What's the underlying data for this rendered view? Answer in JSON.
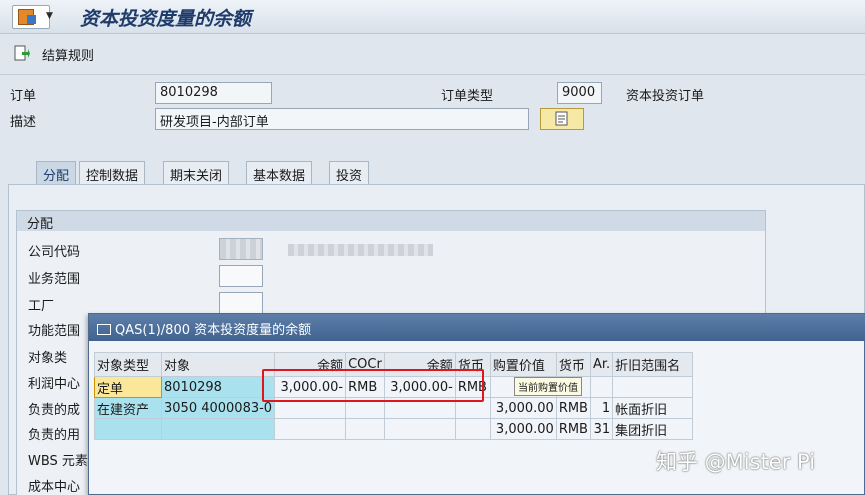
{
  "header": {
    "title": "资本投资度量的余额"
  },
  "toolbar": {
    "settlement_rule_label": "结算规则"
  },
  "order": {
    "order_label": "订单",
    "order_value": "8010298",
    "order_type_label": "订单类型",
    "order_type_value": "9000",
    "order_type_text": "资本投资订单",
    "desc_label": "描述",
    "desc_value": "研发项目-内部订单"
  },
  "tabs": [
    {
      "label": "分配",
      "active": true
    },
    {
      "label": "控制数据",
      "active": false
    },
    {
      "label": "期末关闭",
      "active": false
    },
    {
      "label": "基本数据",
      "active": false
    },
    {
      "label": "投资",
      "active": false
    }
  ],
  "assignment": {
    "group_title": "分配",
    "fields": [
      {
        "label": "公司代码"
      },
      {
        "label": "业务范围"
      },
      {
        "label": "工厂"
      },
      {
        "label": "功能范围"
      },
      {
        "label": "对象类"
      },
      {
        "label": "利润中心"
      },
      {
        "label": "负责的成"
      },
      {
        "label": "负责的用"
      },
      {
        "label": "WBS 元素"
      },
      {
        "label": "成本中心"
      }
    ]
  },
  "popup": {
    "title": "QAS(1)/800 资本投资度量的余额",
    "columns": [
      "对象类型",
      "对象",
      "余额",
      "COCr",
      "余额",
      "货币",
      "购置价值",
      "货币",
      "Ar.",
      "折旧范围名"
    ],
    "rows": [
      [
        "定单",
        "8010298",
        "3,000.00-",
        "RMB",
        "3,000.00-",
        "RMB",
        "",
        "",
        "",
        ""
      ],
      [
        "在建资产",
        "3050 4000083-0",
        "",
        "",
        "",
        "",
        "3,000.00",
        "RMB",
        "1",
        "帐面折旧"
      ],
      [
        "",
        "",
        "",
        "",
        "",
        "",
        "3,000.00",
        "RMB",
        "31",
        "集团折旧"
      ]
    ],
    "tooltip": "当前购置价值"
  },
  "watermark": "知乎 @Mister Pi",
  "colors": {
    "popup_title_bg": "#4a6e9c",
    "key_cell": "#a9e2ee",
    "highlight": "#e0161e",
    "selected_cell": "#fbe79a"
  }
}
